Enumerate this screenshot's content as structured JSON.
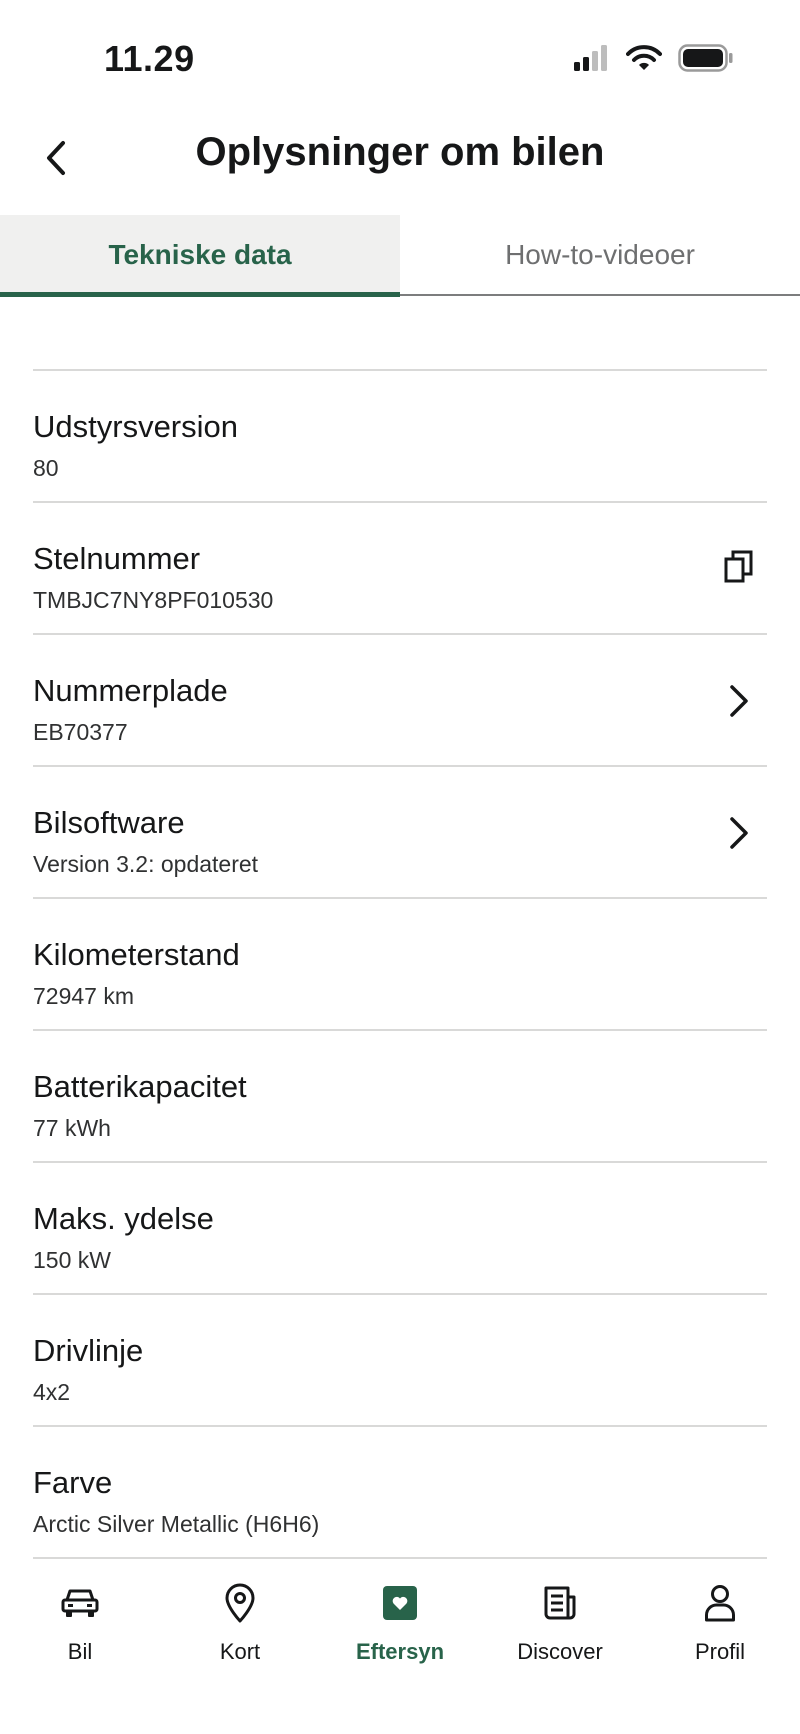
{
  "status_bar": {
    "time": "11.29",
    "icons": [
      "signal-icon",
      "wifi-icon",
      "battery-icon"
    ]
  },
  "header": {
    "title": "Oplysninger om bilen",
    "back_icon": "chevron-left-icon"
  },
  "tabs": [
    {
      "label": "Tekniske data",
      "active": true
    },
    {
      "label": "How-to-videoer",
      "active": false
    }
  ],
  "rows": [
    {
      "label": "Udstyrsversion",
      "value": "80"
    },
    {
      "label": "Stelnummer",
      "value": "TMBJC7NY8PF010530",
      "action": "copy-icon"
    },
    {
      "label": "Nummerplade",
      "value": "EB70377",
      "action": "chevron-right-icon"
    },
    {
      "label": "Bilsoftware",
      "value": "Version 3.2: opdateret",
      "action": "chevron-right-icon"
    },
    {
      "label": "Kilometerstand",
      "value": "72947 km"
    },
    {
      "label": "Batterikapacitet",
      "value": "77 kWh"
    },
    {
      "label": "Maks. ydelse",
      "value": "150 kW"
    },
    {
      "label": "Drivlinje",
      "value": "4x2"
    },
    {
      "label": "Farve",
      "value": "Arctic Silver Metallic (H6H6)"
    }
  ],
  "bottom_nav": [
    {
      "label": "Bil",
      "icon": "car-icon",
      "active": false
    },
    {
      "label": "Kort",
      "icon": "map-pin-icon",
      "active": false
    },
    {
      "label": "Eftersyn",
      "icon": "service-heart-icon",
      "active": true
    },
    {
      "label": "Discover",
      "icon": "news-icon",
      "active": false
    },
    {
      "label": "Profil",
      "icon": "profile-icon",
      "active": false
    }
  ],
  "colors": {
    "accent": "#28634a",
    "divider": "#d9d9d8",
    "tab_active_bg": "#f0f0ef",
    "text": "#161718"
  }
}
